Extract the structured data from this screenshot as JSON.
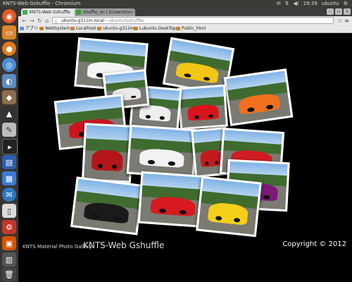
{
  "panel": {
    "window_title": "KNTS-Web Gshuffle - Chromium",
    "indicators": [
      "✉",
      "⇅",
      "◀)",
      "19:39",
      "ubuntu",
      "⚙"
    ]
  },
  "tabs": [
    {
      "label": "KNTS-Web Gshuffle",
      "active": true
    },
    {
      "label": "shuffle_on | Screensho",
      "active": false
    }
  ],
  "toolbar": {
    "url_host": "ubuntu-g311m.local",
    "url_path": "/~ubuntu/Gshuffle/"
  },
  "bookmarks": [
    "アプリ",
    "WebSystem",
    "Localhost",
    "ubuntu-g311m",
    "Lubuntu-DeskTop",
    "Public_html"
  ],
  "photos": [
    {
      "car": "white-lamborghini",
      "color": "#f4f4f4"
    },
    {
      "car": "yellow-porsche",
      "color": "#f2c616"
    },
    {
      "car": "orange-lamborghini",
      "color": "#f0701e"
    },
    {
      "car": "red-ferrari",
      "color": "#d8141c"
    },
    {
      "car": "white-lamborghini-2",
      "color": "#eeeeee"
    },
    {
      "car": "white-car",
      "color": "#e9e9e9"
    },
    {
      "car": "red-porsche",
      "color": "#cc1620"
    },
    {
      "car": "red-interior",
      "color": "#b4151b"
    },
    {
      "car": "white-pagani",
      "color": "#f2f2f2"
    },
    {
      "car": "red-lamborghini-doors",
      "color": "#c41a1f"
    },
    {
      "car": "red-ferrari-2",
      "color": "#d11c24"
    },
    {
      "car": "purple-lamborghini",
      "color": "#7a1b78"
    },
    {
      "car": "black-lamborghini",
      "color": "#1a1a1a"
    },
    {
      "car": "red-ferrari-3",
      "color": "#d8191f"
    },
    {
      "car": "yellow-lamborghini",
      "color": "#f3cf1a"
    }
  ],
  "footer": {
    "site": "KNTS-Material Photo Gallery",
    "title": "KNTS-Web Gshuffle",
    "copyright": "Copyright © 2012"
  }
}
